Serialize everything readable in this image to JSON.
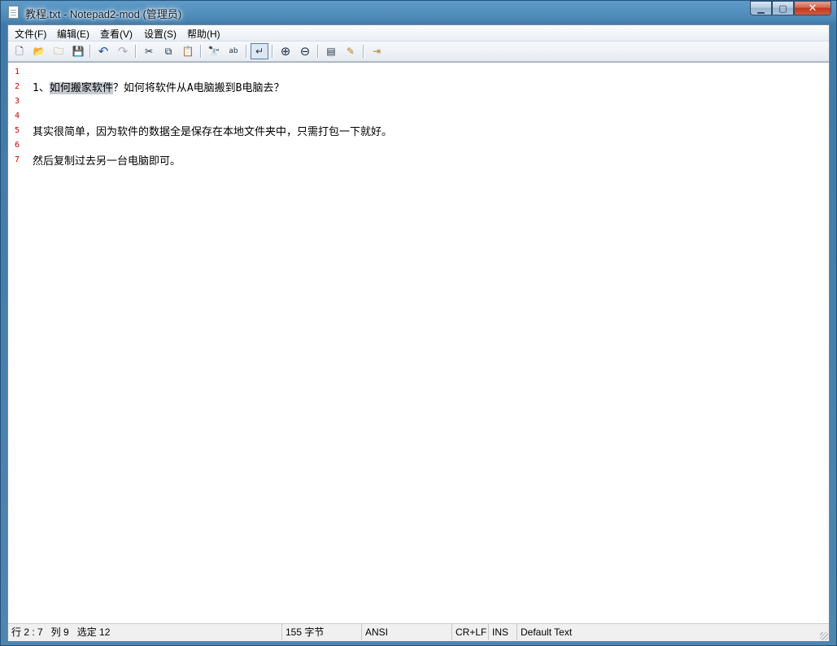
{
  "window": {
    "title": "教程.txt - Notepad2-mod (管理员)",
    "caption_buttons": {
      "minimize": "▁",
      "maximize": "▢",
      "close": "✕"
    }
  },
  "menu": [
    "文件(F)",
    "编辑(E)",
    "查看(V)",
    "设置(S)",
    "帮助(H)"
  ],
  "toolbar": {
    "icons": {
      "new": "🗋",
      "open": "📂",
      "browse": "🗀",
      "save": "💾",
      "undo": "↶",
      "redo": "↷",
      "cut": "✂",
      "copy": "⧉",
      "paste": "📋",
      "find": "🔭",
      "replace": "ab",
      "wordwrap": "↵",
      "zoom_in": "⊕",
      "zoom_out": "⊖",
      "scheme": "▤",
      "customize": "✎",
      "exit": "⇥"
    }
  },
  "editor": {
    "lines": [
      {
        "num": "1",
        "before": "",
        "selected": "",
        "after": ""
      },
      {
        "num": "2",
        "before": "1、",
        "selected": "如何搬家软件",
        "after": "？如何将软件从A电脑搬到B电脑去？"
      },
      {
        "num": "3",
        "before": "",
        "selected": "",
        "after": ""
      },
      {
        "num": "4",
        "before": "",
        "selected": "",
        "after": ""
      },
      {
        "num": "5",
        "before": "其实很简单，因为软件的数据全是保存在本地文件夹中，只需打包一下就好。",
        "selected": "",
        "after": ""
      },
      {
        "num": "6",
        "before": "",
        "selected": "",
        "after": ""
      },
      {
        "num": "7",
        "before": "然后复制过去另一台电脑即可。",
        "selected": "",
        "after": ""
      }
    ]
  },
  "status": {
    "position": "行 2 : 7   列 9   选定 12",
    "size": "155 字节",
    "encoding": "ANSI",
    "eol": "CR+LF",
    "mode": "INS",
    "lexer": "Default Text"
  }
}
